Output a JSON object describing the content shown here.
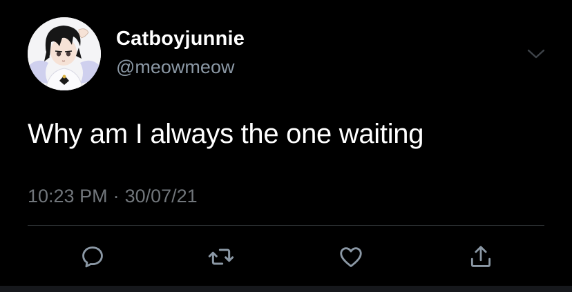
{
  "user": {
    "display_name": "Catboyjunnie",
    "handle": "@meowmeow",
    "avatar_icon": "profile-avatar"
  },
  "tweet": {
    "text": "Why am I always the one waiting",
    "time": "10:23 PM",
    "separator": "·",
    "date": "30/07/21"
  },
  "actions": [
    {
      "name": "reply",
      "icon": "comment-bubble-icon"
    },
    {
      "name": "retweet",
      "icon": "retweet-arrows-icon"
    },
    {
      "name": "like",
      "icon": "heart-icon"
    },
    {
      "name": "share",
      "icon": "share-upload-icon"
    }
  ],
  "colors": {
    "background": "#000000",
    "primary_text": "#ffffff",
    "secondary_text": "#8b98a5",
    "icon": "#8b98a5",
    "divider": "#2f3336"
  }
}
